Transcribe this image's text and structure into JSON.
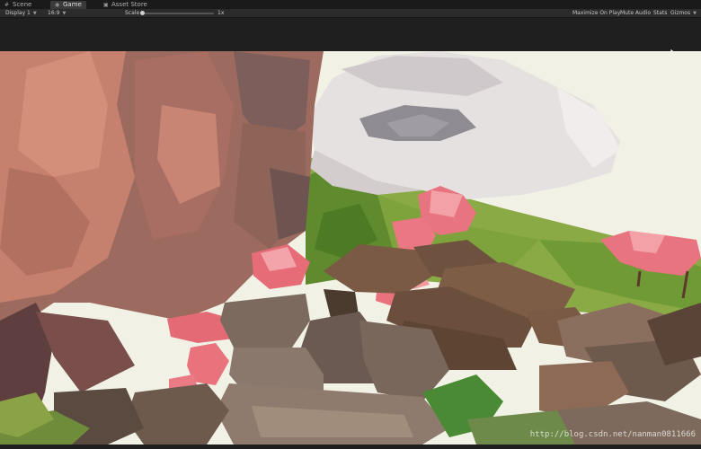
{
  "tabs": [
    {
      "label": "Scene",
      "icon": "scene-icon",
      "active": false
    },
    {
      "label": "Game",
      "icon": "game-icon",
      "active": true
    },
    {
      "label": "Asset Store",
      "icon": "asset-store-icon",
      "active": false
    }
  ],
  "toolbar": {
    "display": "Display 1",
    "aspect": "16:9",
    "scale_label": "Scale",
    "scale_value": "1x",
    "maximize_on_play": "Maximize On Play",
    "mute_audio": "Mute Audio",
    "stats": "Stats",
    "gizmos": "Gizmos"
  },
  "game_view": {
    "watermark": "http://blog.csdn.net/nanman0811666"
  },
  "colors": {
    "sky": "#f1f1e5",
    "cliff": "#b87063",
    "blossom": "#e8747f",
    "grass": "#6f9a35",
    "roof": "#7a5a44",
    "wall": "#7c6a5f"
  }
}
